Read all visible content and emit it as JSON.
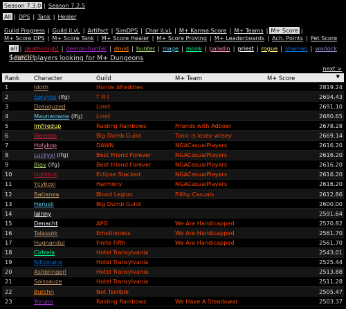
{
  "seasons": [
    "Season 7.3.0",
    "Season 7.2.5"
  ],
  "active_season": 0,
  "roles": [
    "All",
    "DPS",
    "Tank",
    "Healer"
  ],
  "active_role": 0,
  "nav_links": [
    "Guild Progress",
    "Guild iLvL",
    "Artifact",
    "SimDPS",
    "Char iLvL",
    "M+ Karma Score",
    "M+ Teams",
    "M+ Score",
    "M+ Score DPS",
    "M+ Score Tank",
    "M+ Score Healer",
    "M+ Score Proving",
    "M+ Leaderboards",
    "Ach. Points",
    "Pet Score"
  ],
  "active_nav": 7,
  "class_filters": [
    {
      "label": "all",
      "color": "#dddddd"
    },
    {
      "label": "deathknight",
      "color": "#C41F3B"
    },
    {
      "label": "demon-hunter",
      "color": "#A330C9"
    },
    {
      "label": "druid",
      "color": "#FF7D0A"
    },
    {
      "label": "hunter",
      "color": "#ABD473"
    },
    {
      "label": "mage",
      "color": "#69CCF0"
    },
    {
      "label": "monk",
      "color": "#00FF96"
    },
    {
      "label": "paladin",
      "color": "#F58CBA"
    },
    {
      "label": "priest",
      "color": "#FFFFFF"
    },
    {
      "label": "rogue",
      "color": "#FFF569"
    },
    {
      "label": "shaman",
      "color": "#0070DE"
    },
    {
      "label": "warlock",
      "color": "#9482C9"
    },
    {
      "label": "warrior",
      "color": "#C79C6E"
    }
  ],
  "active_class": 0,
  "search_link": "Search players looking for M+ Dungeons",
  "next_link": "next >",
  "table": {
    "headers": {
      "rank": "Rank",
      "character": "Character",
      "guild": "Guild",
      "team": "M+ Team",
      "score": "M+ Score",
      "sort_arrow": "▼"
    },
    "rows": [
      {
        "rank": "1",
        "character": "Idoth",
        "lfg": "",
        "char_color": "#C79C6E",
        "guild": "Homie Afreddies",
        "team": "",
        "score": "2819.24"
      },
      {
        "rank": "2",
        "character": "Sorvyos",
        "lfg": "(lfg)",
        "char_color": "#0070DE",
        "guild": "T R I",
        "team": "",
        "score": "2694.43"
      },
      {
        "rank": "3",
        "character": "Dosoquzed",
        "lfg": "",
        "char_color": "#C79C6E",
        "guild": "Limit",
        "team": "",
        "score": "2691.10"
      },
      {
        "rank": "4",
        "character": "Maunwowne",
        "lfg": "(lfg)",
        "char_color": "#69CCF0",
        "guild": "Limit",
        "team": "",
        "score": "2680.65"
      },
      {
        "rank": "5",
        "character": "Imfiredup",
        "lfg": "",
        "char_color": "#FFF569",
        "guild": "Raiding Rainbows",
        "team": "Friends with Adboer",
        "score": "2678.28"
      },
      {
        "rank": "6",
        "character": "Weedeb",
        "lfg": "",
        "char_color": "#C41F3B",
        "guild": "Big Dumb Guild",
        "team": "Tonic is losey wilsey",
        "score": "2669.14"
      },
      {
        "rank": "7",
        "character": "Holykop",
        "lfg": "",
        "char_color": "#F58CBA",
        "guild": "DAWN",
        "team": "NGACasualPlayers",
        "score": "2616.20"
      },
      {
        "rank": "8",
        "character": "Luckyxi",
        "lfg": "(lfg)",
        "char_color": "#9482C9",
        "guild": "Best Friend Forever",
        "team": "NGACasualPlayers",
        "score": "2616.20"
      },
      {
        "rank": "9",
        "character": "Bigy",
        "lfg": "(lfg)",
        "char_color": "#ABD473",
        "guild": "Best Friend Forever",
        "team": "NGACasualPlayers",
        "score": "2616.20"
      },
      {
        "rank": "10",
        "character": "Lightbot",
        "lfg": "",
        "char_color": "#C41F3B",
        "guild": "Eclipse Stacked",
        "team": "NGACasualPlayers",
        "score": "2616.20"
      },
      {
        "rank": "11",
        "character": "Ycyboxi",
        "lfg": "",
        "char_color": "#C79C6E",
        "guild": "Harmony",
        "team": "NGACasualPlayers",
        "score": "2616.20"
      },
      {
        "rank": "12",
        "character": "Batianea",
        "lfg": "",
        "char_color": "#C79C6E",
        "guild": "Blood Legion",
        "team": "Filthy Casuals",
        "score": "2612.86"
      },
      {
        "rank": "13",
        "character": "Herusk",
        "lfg": "",
        "char_color": "#69CCF0",
        "guild": "Big Dumb Guild",
        "team": "",
        "score": "2600.00"
      },
      {
        "rank": "14",
        "character": "Jalnny",
        "lfg": "",
        "char_color": "#FFFFFF",
        "guild": "",
        "team": "",
        "score": "2591.64"
      },
      {
        "rank": "15",
        "character": "Denacht",
        "lfg": "",
        "char_color": "#FFFFFF",
        "guild": "APG",
        "team": "We Are Handicapped",
        "score": "2570.82"
      },
      {
        "rank": "16",
        "character": "Talassnk",
        "lfg": "",
        "char_color": "#C79C6E",
        "guild": "Emotionless",
        "team": "We Are Handicapped",
        "score": "2561.70"
      },
      {
        "rank": "17",
        "character": "Hugnandul",
        "lfg": "",
        "char_color": "#C79C6E",
        "guild": "Finite Fifth",
        "team": "We Are Handicapped",
        "score": "2561.70"
      },
      {
        "rank": "18",
        "character": "Cirtrela",
        "lfg": "",
        "char_color": "#00FF96",
        "guild": "Hotel Transylvania",
        "team": "",
        "score": "2543.01"
      },
      {
        "rank": "19",
        "character": "Nillionaire",
        "lfg": "",
        "char_color": "#0070DE",
        "guild": "Hotel Transylvania",
        "team": "",
        "score": "2525.44"
      },
      {
        "rank": "20",
        "character": "Ashbringerl",
        "lfg": "",
        "char_color": "#C79C6E",
        "guild": "Hotel Transylvania",
        "team": "",
        "score": "2513.88"
      },
      {
        "rank": "21",
        "character": "Soissauze",
        "lfg": "",
        "char_color": "#C79C6E",
        "guild": "Hotel Transylvania",
        "team": "",
        "score": "2511.28"
      },
      {
        "rank": "22",
        "character": "Butchn",
        "lfg": "",
        "char_color": "#FF7D0A",
        "guild": "Not Terrible",
        "team": "",
        "score": "2505.47"
      },
      {
        "rank": "23",
        "character": "Yoruno",
        "lfg": "",
        "char_color": "#A330C9",
        "guild": "Raiding Rainbows",
        "team": "We Have A Steadower",
        "score": "2503.37"
      }
    ]
  },
  "colors": {
    "background": "#000000",
    "guild_text": "#ff4400",
    "header_bg": "#e8e8e8"
  }
}
